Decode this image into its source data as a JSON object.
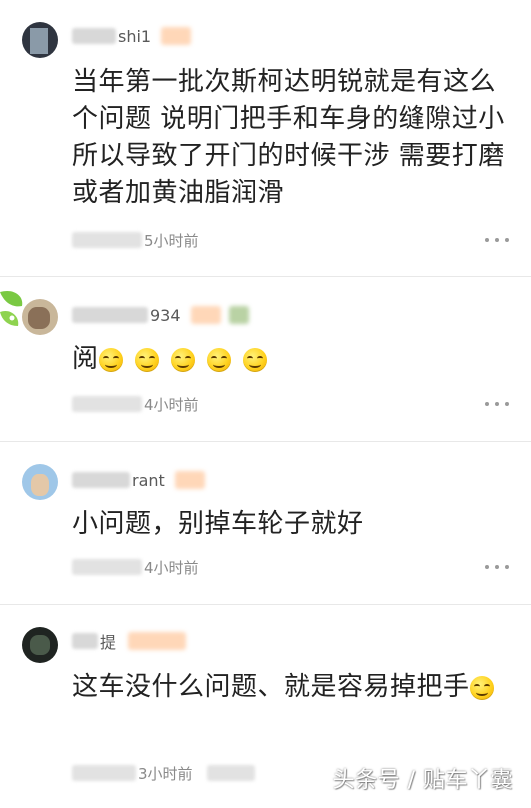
{
  "comments": [
    {
      "username_visible": "shi1",
      "text": "当年第一批次斯柯达明锐就是有这么个问题 说明门把手和车身的缝隙过小 所以导致了开门的时候干涉 需要打磨或者加黄油脂润滑",
      "time": "5小时前"
    },
    {
      "username_visible": "934",
      "text": "阅",
      "emoji_icon": "grin-emoji-icon",
      "emoji_count": 5,
      "time": "4小时前"
    },
    {
      "username_visible": "rant",
      "text": "小问题，别掉车轮子就好",
      "time": "4小时前"
    },
    {
      "username_visible": "提",
      "text": "这车没什么问题、就是容易掉把手",
      "emoji_icon": "grin-emoji-icon",
      "emoji_count": 1,
      "time": "3小时前"
    }
  ],
  "watermark": "头条号 / 贴车丫囊",
  "colors": {
    "text": "#222222",
    "meta": "#8a8a8a",
    "divider": "#e8e8e8",
    "badge": "#ffd7b8"
  }
}
